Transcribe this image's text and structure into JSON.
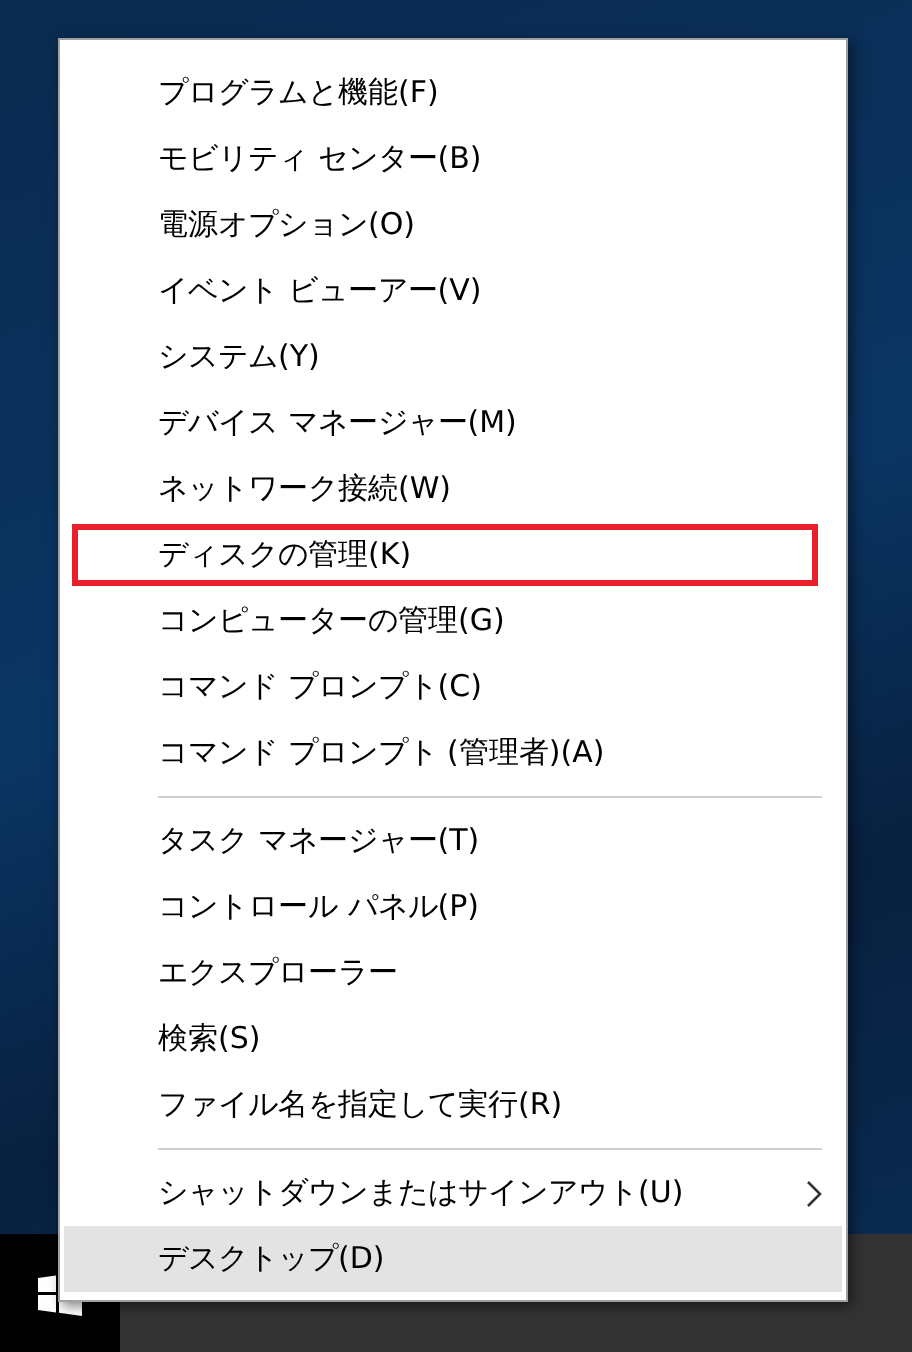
{
  "menu": {
    "groups": [
      {
        "items": [
          {
            "label": "プログラムと機能(F)",
            "selected": false,
            "highlighted": false,
            "has_submenu": false
          },
          {
            "label": "モビリティ センター(B)",
            "selected": false,
            "highlighted": false,
            "has_submenu": false
          },
          {
            "label": "電源オプション(O)",
            "selected": false,
            "highlighted": false,
            "has_submenu": false
          },
          {
            "label": "イベント ビューアー(V)",
            "selected": false,
            "highlighted": false,
            "has_submenu": false
          },
          {
            "label": "システム(Y)",
            "selected": false,
            "highlighted": false,
            "has_submenu": false
          },
          {
            "label": "デバイス マネージャー(M)",
            "selected": false,
            "highlighted": false,
            "has_submenu": false
          },
          {
            "label": "ネットワーク接続(W)",
            "selected": false,
            "highlighted": false,
            "has_submenu": false
          },
          {
            "label": "ディスクの管理(K)",
            "selected": false,
            "highlighted": true,
            "has_submenu": false
          },
          {
            "label": "コンピューターの管理(G)",
            "selected": false,
            "highlighted": false,
            "has_submenu": false
          },
          {
            "label": "コマンド プロンプト(C)",
            "selected": false,
            "highlighted": false,
            "has_submenu": false
          },
          {
            "label": "コマンド プロンプト (管理者)(A)",
            "selected": false,
            "highlighted": false,
            "has_submenu": false
          }
        ]
      },
      {
        "items": [
          {
            "label": "タスク マネージャー(T)",
            "selected": false,
            "highlighted": false,
            "has_submenu": false
          },
          {
            "label": "コントロール パネル(P)",
            "selected": false,
            "highlighted": false,
            "has_submenu": false
          },
          {
            "label": "エクスプローラー",
            "selected": false,
            "highlighted": false,
            "has_submenu": false
          },
          {
            "label": "検索(S)",
            "selected": false,
            "highlighted": false,
            "has_submenu": false
          },
          {
            "label": "ファイル名を指定して実行(R)",
            "selected": false,
            "highlighted": false,
            "has_submenu": false
          }
        ]
      },
      {
        "items": [
          {
            "label": "シャットダウンまたはサインアウト(U)",
            "selected": false,
            "highlighted": false,
            "has_submenu": true
          },
          {
            "label": "デスクトップ(D)",
            "selected": true,
            "highlighted": false,
            "has_submenu": false
          }
        ]
      }
    ]
  }
}
